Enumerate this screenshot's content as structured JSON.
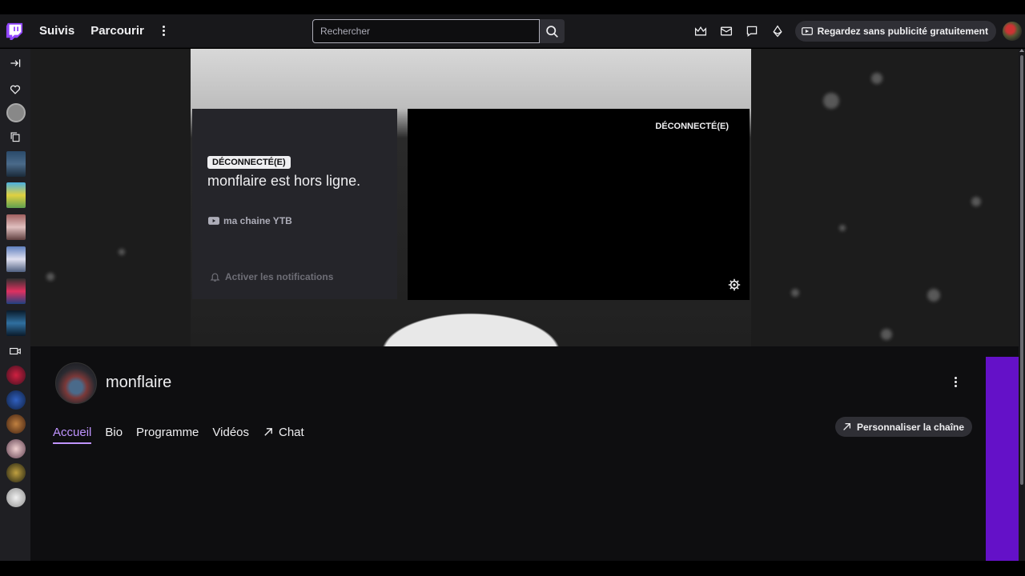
{
  "nav": {
    "following": "Suivis",
    "browse": "Parcourir",
    "search_placeholder": "Rechercher",
    "turbo_label": "Regardez sans publicité gratuitement"
  },
  "sidebar": {
    "icons": [
      "collapse-icon",
      "heart-icon",
      "copy-icon",
      "camera-icon"
    ]
  },
  "offline_card": {
    "badge": "DÉCONNECTÉ(E)",
    "title": "monflaire est hors ligne.",
    "link_label": "ma chaine YTB",
    "notif_label": "Activer les notifications"
  },
  "player": {
    "status": "DÉCONNECTÉ(E)"
  },
  "channel": {
    "name": "monflaire",
    "customize_label": "Personnaliser la chaîne",
    "tabs": [
      "Accueil",
      "Bio",
      "Programme",
      "Vidéos",
      "Chat"
    ],
    "active_tab": "Accueil"
  },
  "colors": {
    "accent": "#9146ff",
    "accent_light": "#bf94ff",
    "bg": "#0e0e10",
    "strip": "#6411c8"
  }
}
